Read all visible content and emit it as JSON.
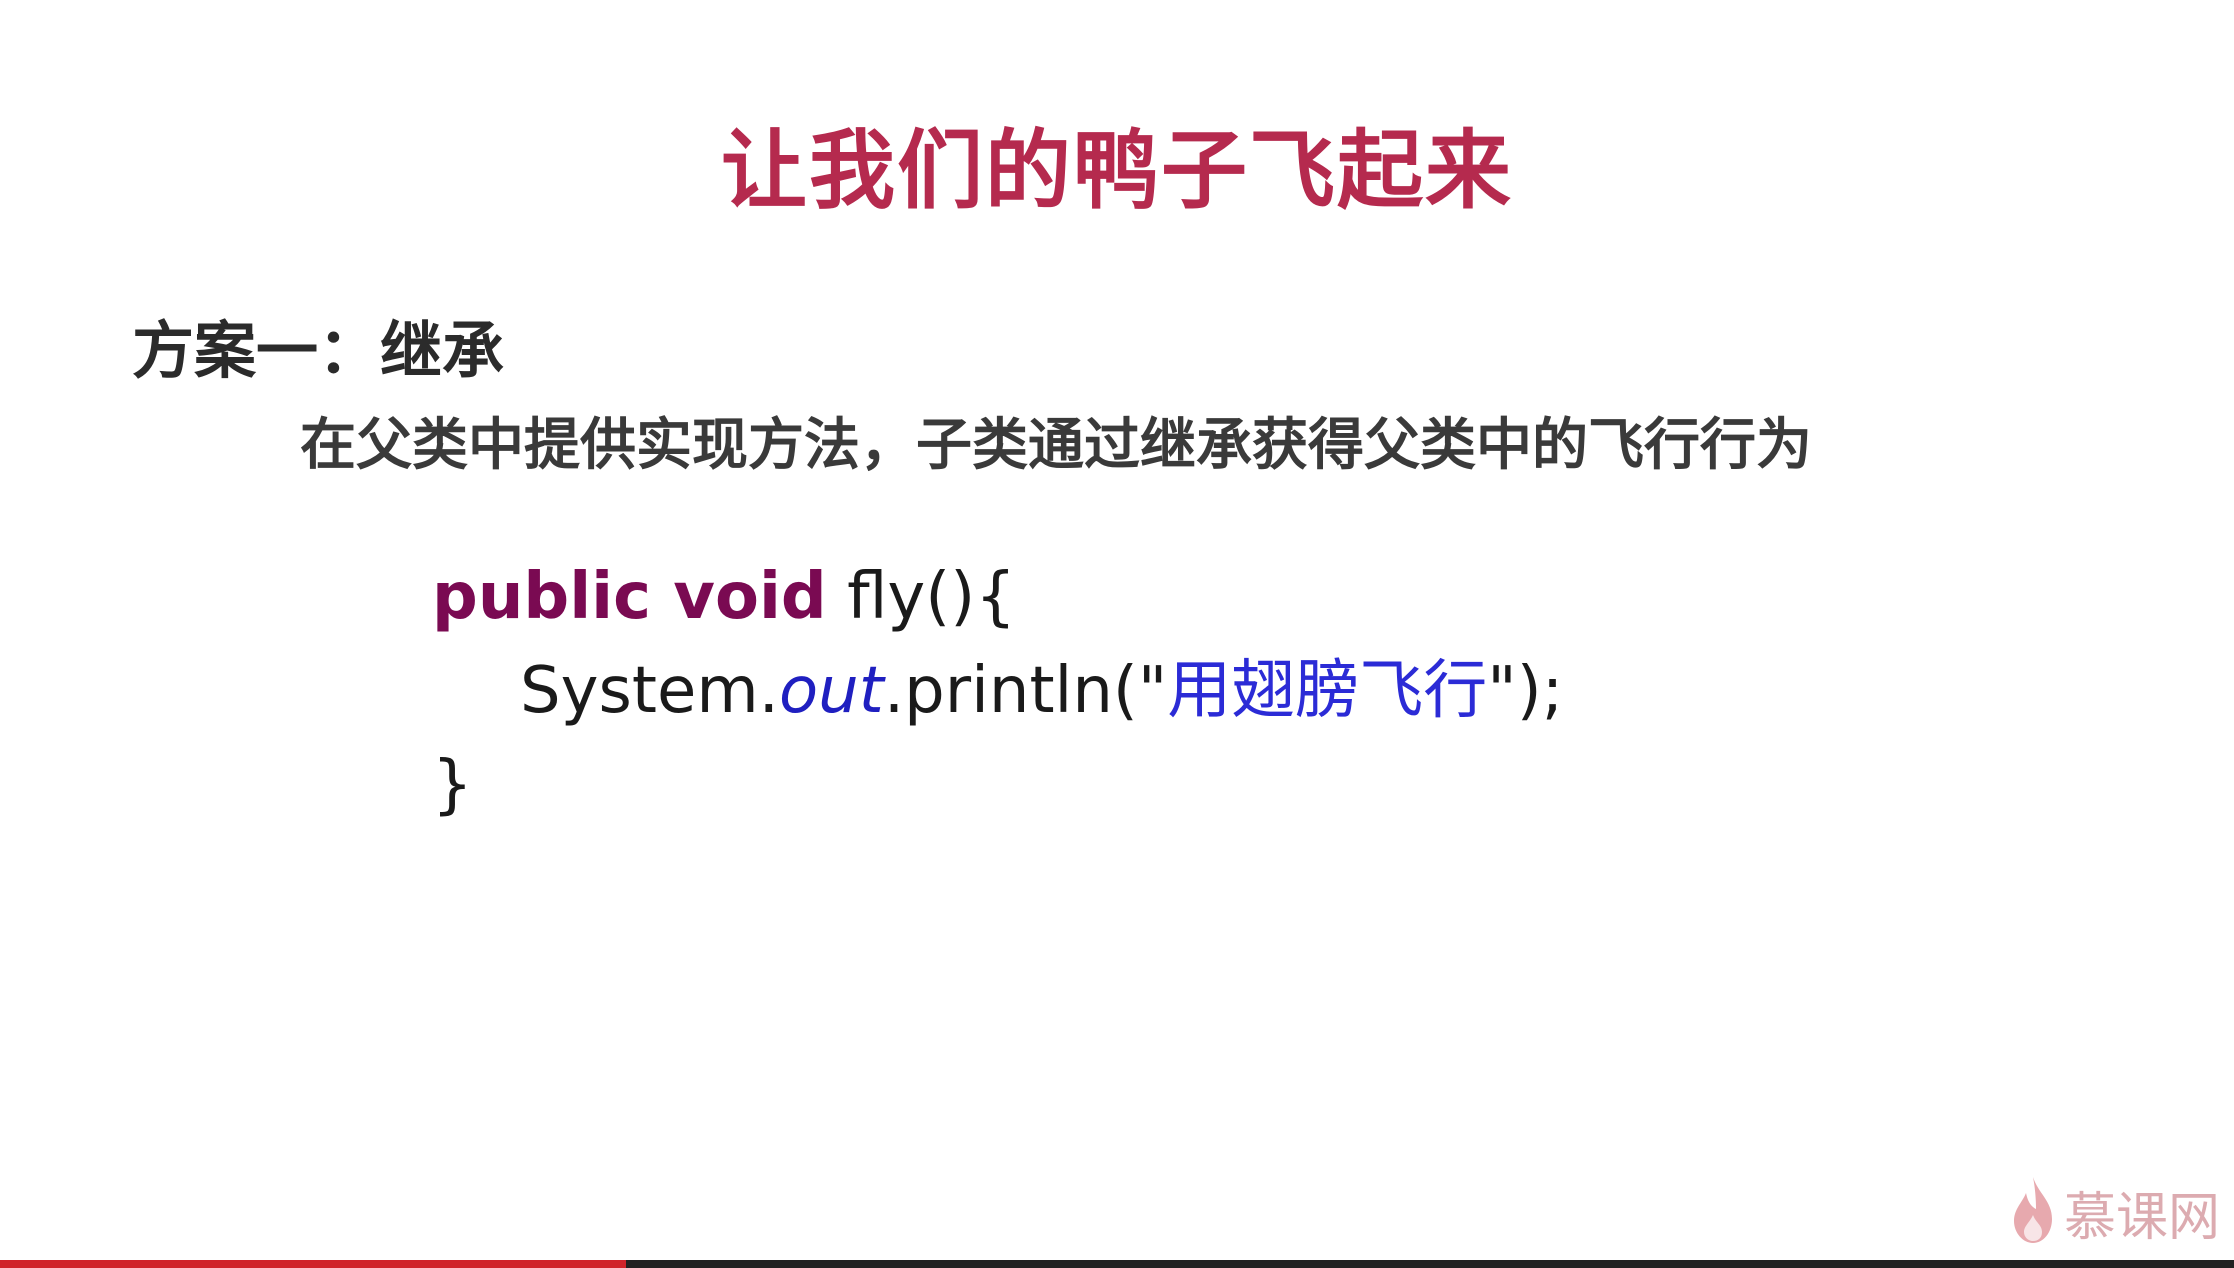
{
  "slide": {
    "title": "让我们的鸭子飞起来",
    "heading": "方案一：继承",
    "description": "在父类中提供实现方法，子类通过继承获得父类中的飞行行为"
  },
  "code": {
    "line1_keyword": "public void",
    "line1_rest": " fly(){",
    "line2_prefix": "System.",
    "line2_field": "out",
    "line2_method": ".println(\"",
    "line2_string": "用翅膀飞行",
    "line2_suffix": "\");",
    "line3": "}"
  },
  "watermark": {
    "text": "慕课网",
    "icon": "flame-icon"
  },
  "video": {
    "progress_fraction": 0.28
  },
  "colors": {
    "title": "#b52a4e",
    "keyword": "#7a0a52",
    "string": "#2b2bd6",
    "progress": "#d0242b"
  }
}
